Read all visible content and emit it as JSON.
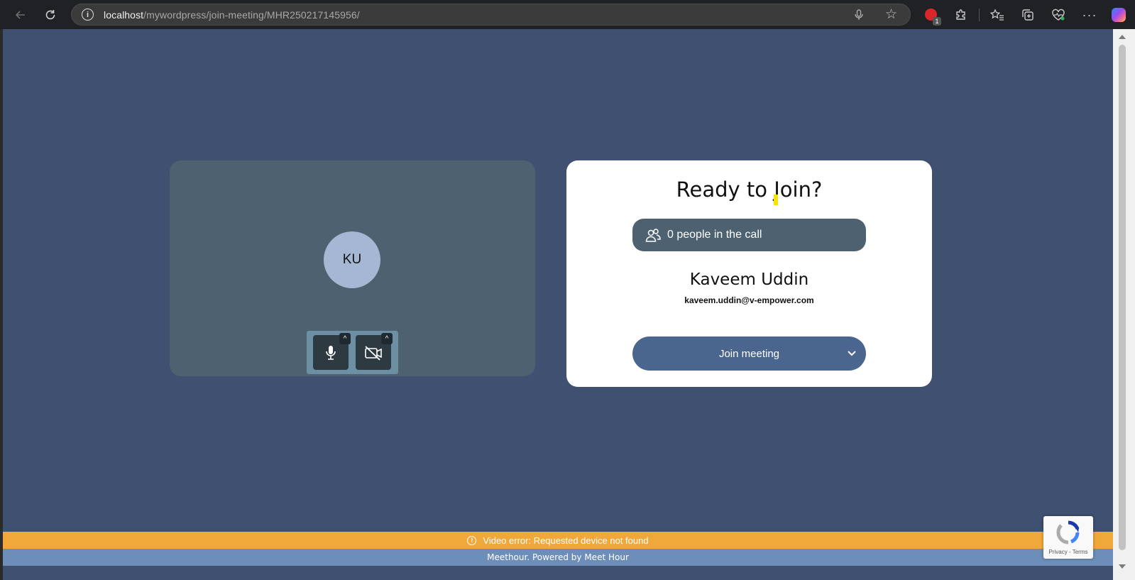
{
  "browser": {
    "url_host": "localhost",
    "url_path": "/mywordpress/join-meeting/MHR250217145956/",
    "extension_badge": "1"
  },
  "preview": {
    "avatar_initials": "KU"
  },
  "card": {
    "title": "Ready to Join?",
    "participants_text": "0 people in the call",
    "user_name": "Kaveem Uddin",
    "user_email": "kaveem.uddin@v-empower.com",
    "join_label": "Join meeting"
  },
  "notices": {
    "error_text": "Video error: Requested device not found",
    "footer_text": "Meethour. Powered by Meet Hour"
  },
  "recaptcha": {
    "privacy": "Privacy",
    "terms": "Terms"
  },
  "colors": {
    "page_bg": "#3f5070",
    "panel_bg": "#4e6170",
    "join_button": "#4a668f",
    "error_bar": "#f0a83a",
    "footer_bar": "#6d8eb9"
  },
  "icons": [
    "back-icon",
    "reload-icon",
    "info-icon",
    "mic-icon",
    "star-icon",
    "extension-icon",
    "puzzle-icon",
    "favorites-icon",
    "collections-icon",
    "heart-pulse-icon",
    "more-icon",
    "copilot-icon",
    "people-icon",
    "camera-off-icon",
    "chevron-down-icon",
    "alert-icon",
    "recaptcha-icon"
  ]
}
